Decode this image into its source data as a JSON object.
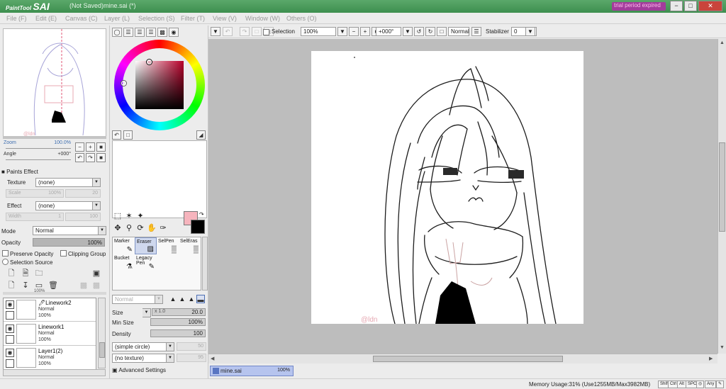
{
  "title_bar": {
    "logo_small": "PaintTool",
    "logo_big": "SAI",
    "window_title": "(Not Saved)mine.sai (*)",
    "trial_badge": "trial period expired",
    "buttons": [
      "−",
      "□",
      "✕"
    ]
  },
  "menu": {
    "items": [
      "File (F)",
      "Edit (E)",
      "Canvas (C)",
      "Layer (L)",
      "Selection (S)",
      "Filter (T)",
      "View (V)",
      "Window (W)",
      "Others (O)"
    ]
  },
  "navigator": {
    "zoom_label": "Zoom",
    "zoom_value": "100.0%",
    "angle_label": "Angle",
    "angle_value": "+000°",
    "zoom_buttons": [
      "−",
      "+",
      "■"
    ],
    "angle_buttons": [
      "↶",
      "↷",
      "■"
    ]
  },
  "paints_effect": {
    "title": "Paints Effect",
    "texture_label": "Texture",
    "texture_value": "(none)",
    "scale_label": "Scale",
    "scale_value": "100%",
    "scale_num": "20",
    "effect_label": "Effect",
    "effect_value": "(none)",
    "width_label": "Width",
    "width_value": "1",
    "width_num": "100"
  },
  "layer_props": {
    "mode_label": "Mode",
    "mode_value": "Normal",
    "opacity_label": "Opacity",
    "opacity_value": "100%",
    "opacity_fraction": 1.0,
    "preserve_opacity": "Preserve Opacity",
    "clipping_group": "Clipping Group",
    "selection_source": "Selection Source"
  },
  "layers": [
    {
      "name": "Linework2",
      "mode": "Normal",
      "opacity": "100%",
      "pen_icon": "🖊"
    },
    {
      "name": "Linework1",
      "mode": "Normal",
      "opacity": "100%"
    },
    {
      "name": "Layer1(2)",
      "mode": "Normal",
      "opacity": "100%"
    }
  ],
  "layer_strip_value": "100%",
  "tools": {
    "grid": [
      {
        "name": "Marker",
        "icon": "✎"
      },
      {
        "name": "Eraser",
        "icon": "▨"
      },
      {
        "name": "SelPen",
        "icon": "▒"
      },
      {
        "name": "SelEras",
        "icon": "▒"
      },
      {
        "name": "Bucket",
        "icon": "⚗"
      },
      {
        "name": "Legacy Pen",
        "icon": "✎"
      }
    ],
    "blend_mode": "Normal",
    "size_label": "Size",
    "size_multiplier": "x 1.0",
    "size_value": "20.0",
    "min_size_label": "Min Size",
    "min_size_value": "100%",
    "density_label": "Density",
    "density_value": "100",
    "shape_value": "(simple circle)",
    "shape_num": "50",
    "texture_value": "(no texture)",
    "texture_num": "95",
    "advanced": "Advanced Settings"
  },
  "toolbar": {
    "selection_label": "Selection",
    "zoom_value": "100%",
    "angle_value": "+000°",
    "blend_value": "Normal",
    "stabilizer_label": "Stabilizer",
    "stabilizer_value": "0"
  },
  "canvas": {
    "watermark": "@ldn",
    "hscroll_position": 0.52,
    "vscroll_position": 0.4
  },
  "file_tab": {
    "name": "mine.sai",
    "zoom": "100%"
  },
  "status": {
    "memory": "Memory Usage:31% (Use1255MB/Max3982MB)",
    "keys": [
      "Shift",
      "Ctrl",
      "Alt",
      "SPC",
      "◎",
      "Any",
      "✎"
    ]
  }
}
